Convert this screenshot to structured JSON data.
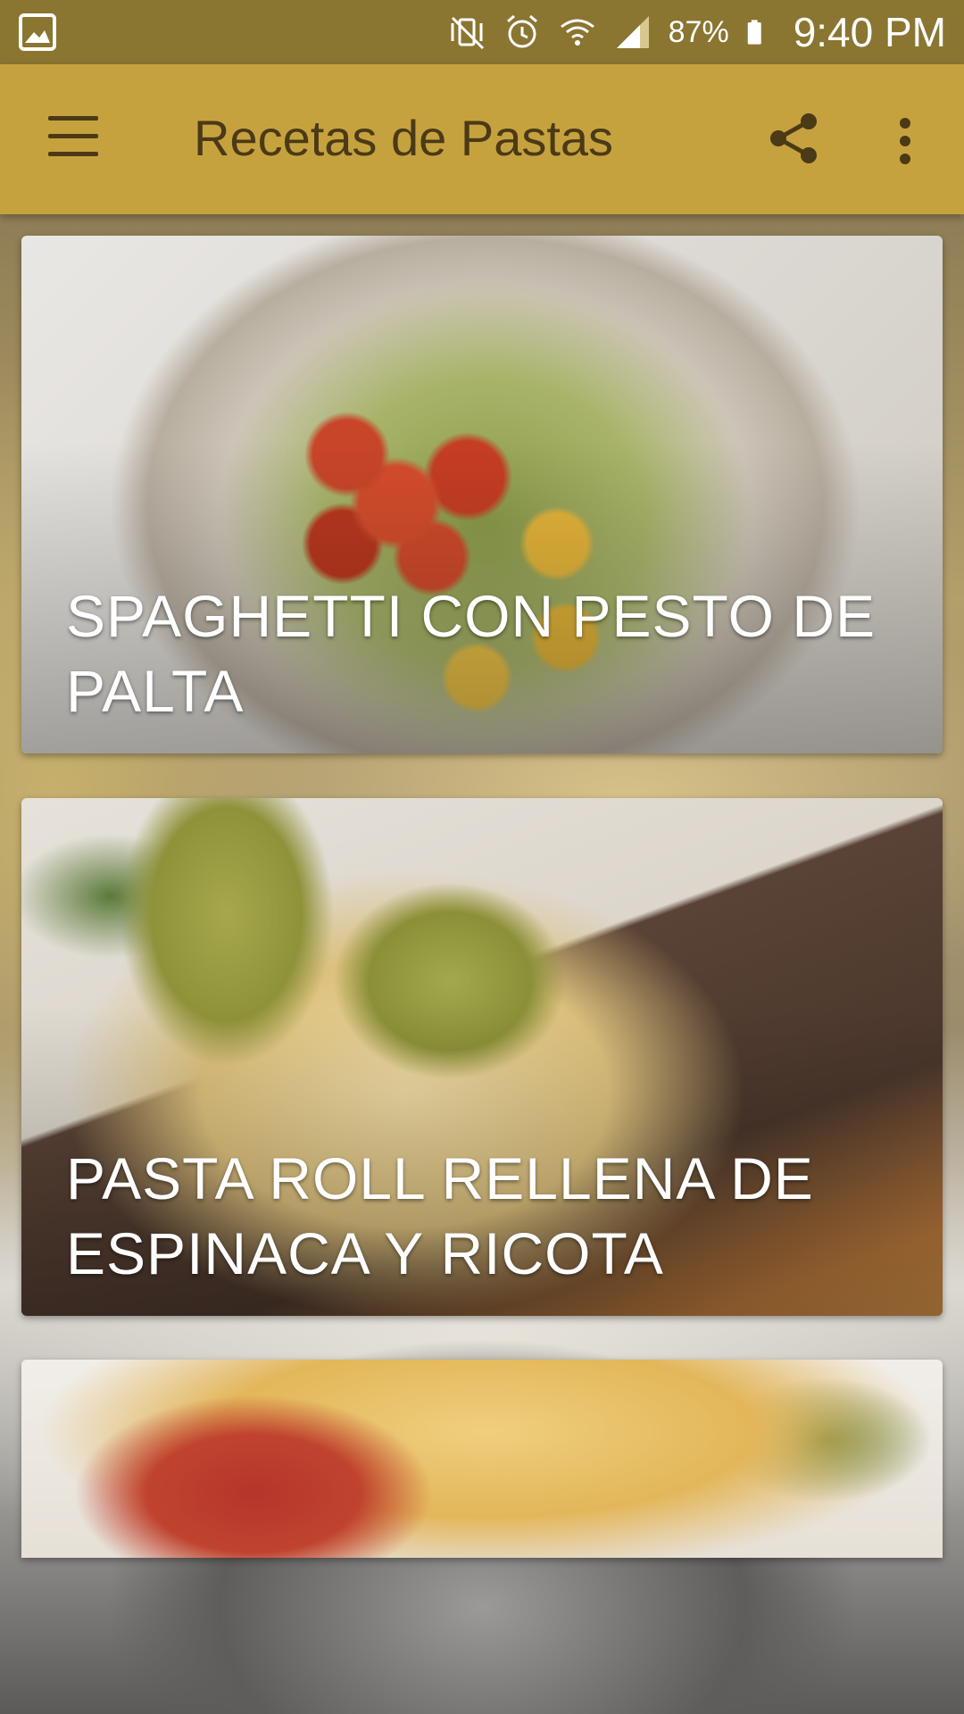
{
  "status_bar": {
    "battery": "87%",
    "time": "9:40 PM",
    "icons": [
      "image-notification-icon",
      "vibrate-mute-icon",
      "alarm-icon",
      "wifi-icon",
      "signal-icon",
      "battery-icon"
    ]
  },
  "app_bar": {
    "title": "Recetas de Pastas",
    "icons": [
      "menu-icon",
      "share-icon",
      "more-vert-icon"
    ]
  },
  "recipes": [
    {
      "title": "SPAGHETTI CON PESTO DE PALTA"
    },
    {
      "title": "PASTA ROLL RELLENA DE ESPINACA Y RICOTA"
    },
    {
      "title": ""
    }
  ],
  "colors": {
    "status_bar": "#8a7531",
    "app_bar": "#c6a23f",
    "app_bar_text": "#4a3a16"
  }
}
